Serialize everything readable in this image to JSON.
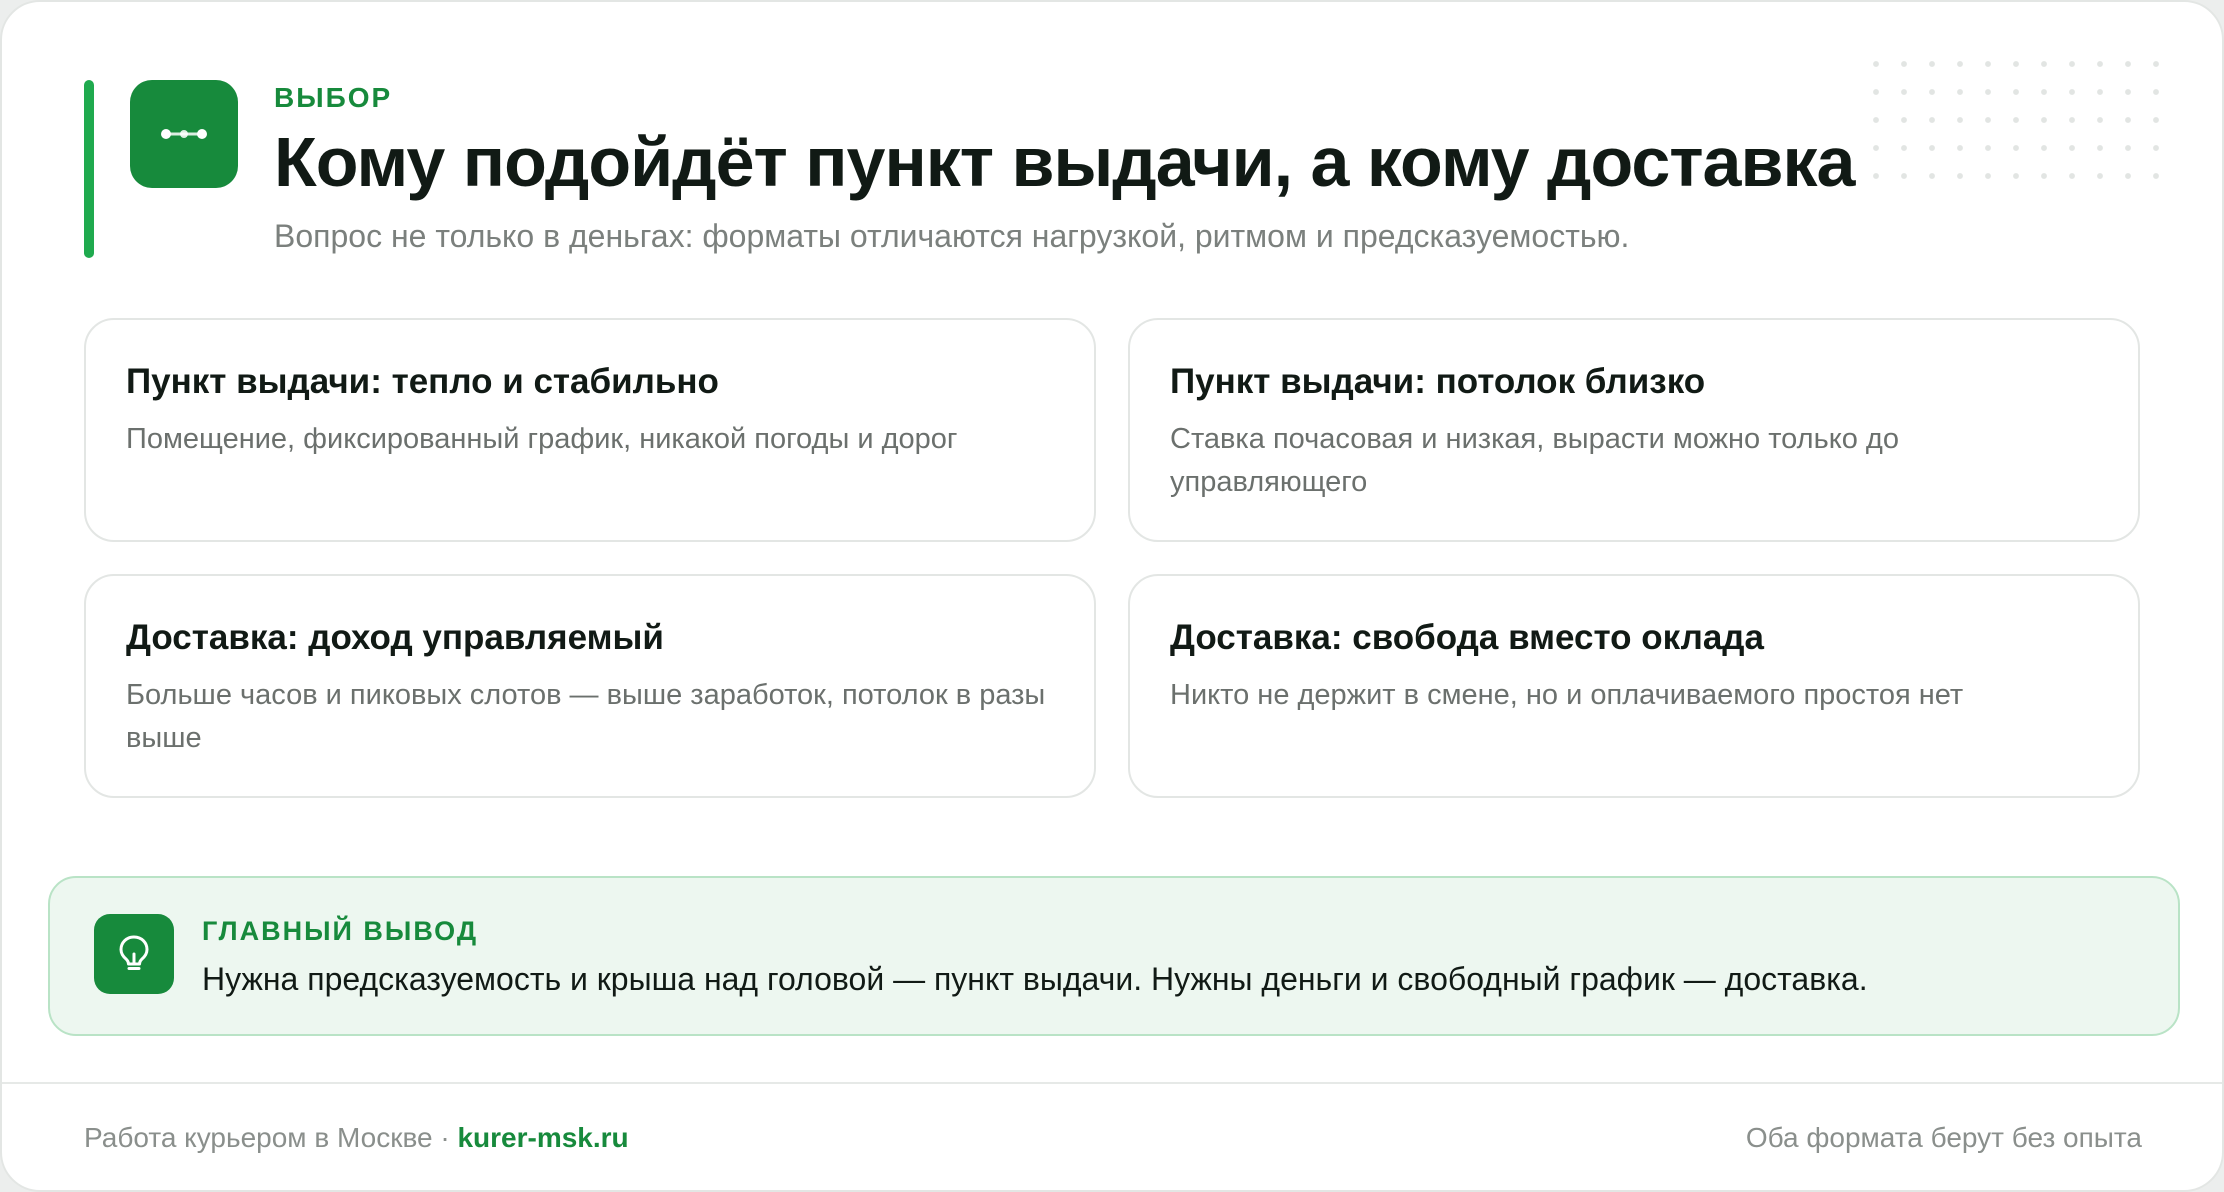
{
  "header": {
    "eyebrow": "ВЫБОР",
    "title": "Кому подойдёт пункт выдачи, а кому доставка",
    "subtitle": "Вопрос не только в деньгах: форматы отличаются нагрузкой, ритмом и предсказуемостью.",
    "logo_icon": "route-dots-icon"
  },
  "cards": [
    {
      "title": "Пункт выдачи: тепло и стабильно",
      "text": "Помещение, фиксированный график, никакой погоды и дорог"
    },
    {
      "title": "Пункт выдачи: потолок близко",
      "text": "Ставка почасовая и низкая, вырасти можно только до управляющего"
    },
    {
      "title": "Доставка: доход управляемый",
      "text": "Больше часов и пиковых слотов — выше заработок, потолок в разы выше"
    },
    {
      "title": "Доставка: свобода вместо оклада",
      "text": "Никто не держит в смене, но и оплачиваемого простоя нет"
    }
  ],
  "conclusion": {
    "eyebrow": "ГЛАВНЫЙ ВЫВОД",
    "text": "Нужна предсказуемость и крыша над головой — пункт выдачи. Нужны деньги и свободный график — доставка.",
    "icon": "lightbulb-icon"
  },
  "footer": {
    "left_text": "Работа курьером в Москве · ",
    "link": "kurer-msk.ru",
    "right_text": "Оба формата берут без опыта"
  },
  "colors": {
    "accent": "#178a3c",
    "accent_bar": "#1faa4e",
    "conclusion_bg": "#edf7f0",
    "text_dark": "#111a15",
    "text_muted": "#7b807d"
  }
}
